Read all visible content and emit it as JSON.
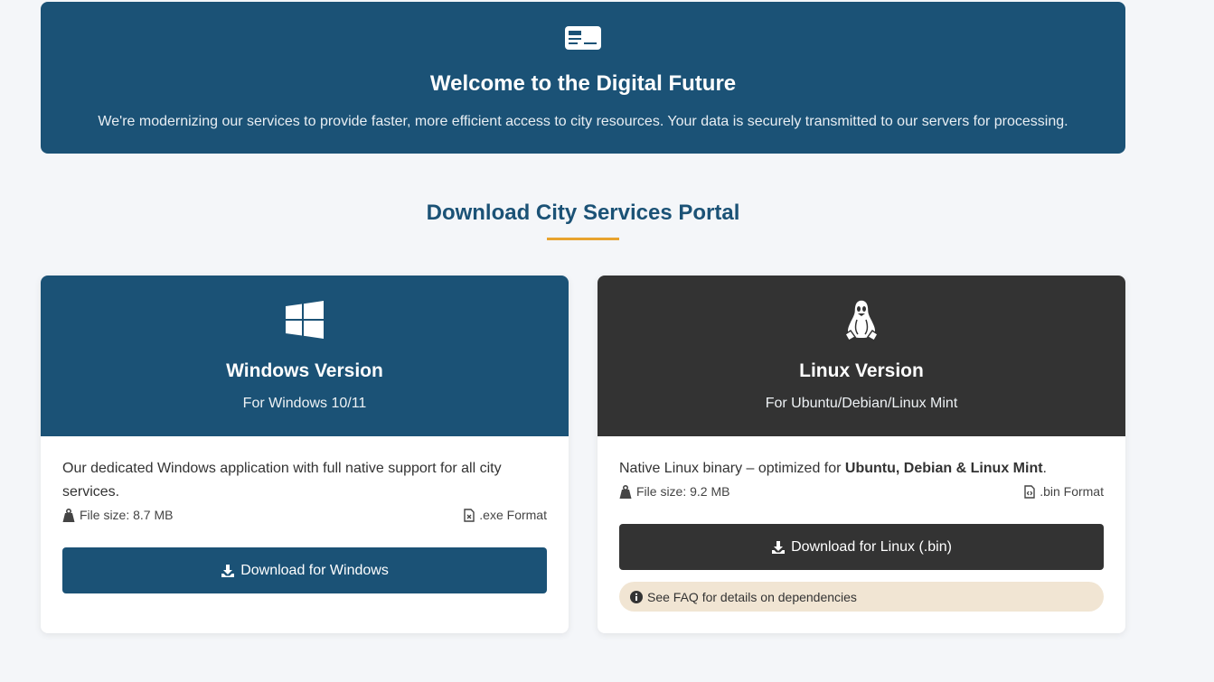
{
  "hero": {
    "icon": "id-card-icon",
    "title": "Welcome to the Digital Future",
    "text": "We're modernizing our services to provide faster, more efficient access to city resources. Your data is securely transmitted to our servers for processing."
  },
  "section": {
    "title": "Download City Services Portal",
    "accent_color": "#e8a32e"
  },
  "windows": {
    "icon": "windows-logo-icon",
    "title": "Windows Version",
    "subtitle": "For Windows 10/11",
    "description": "Our dedicated Windows application with full native support for all city services.",
    "file_size": "File size: 8.7 MB",
    "format": ".exe Format",
    "button": "Download for Windows",
    "color": "#1b5276"
  },
  "linux": {
    "icon": "linux-tux-icon",
    "title": "Linux Version",
    "subtitle": "For Ubuntu/Debian/Linux Mint",
    "description_prefix": "Native Linux binary – optimized for ",
    "description_bold": "Ubuntu, Debian & Linux Mint",
    "description_suffix": ".",
    "file_size": "File size: 9.2 MB",
    "format": ".bin Format",
    "button": "Download for Linux (.bin)",
    "faq": "See FAQ for details on dependencies",
    "color": "#333333"
  }
}
